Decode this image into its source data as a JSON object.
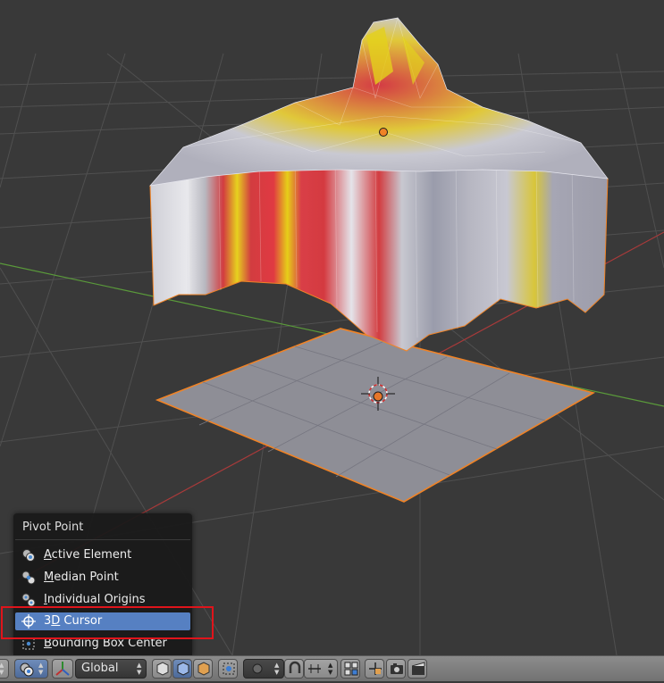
{
  "popup": {
    "title": "Pivot Point",
    "items": [
      {
        "label_hotkey": "A",
        "label_rest": "ctive Element",
        "icon": "active-element-icon",
        "selected": false
      },
      {
        "label_hotkey": "M",
        "label_rest": "edian Point",
        "icon": "median-point-icon",
        "selected": false
      },
      {
        "label_hotkey": "I",
        "label_rest": "ndividual Origins",
        "icon": "individual-origins-icon",
        "selected": false
      },
      {
        "label_pre": "3",
        "label_hotkey": "D",
        "label_rest": " Cursor",
        "icon": "cursor-3d-icon",
        "selected": true
      },
      {
        "label_hotkey": "B",
        "label_rest": "ounding Box Center",
        "icon": "bounding-box-center-icon",
        "selected": false
      }
    ]
  },
  "toolbar": {
    "orientation_value": "Global",
    "icons": [
      "pivot-point-icon",
      "transform-manipulator-icon",
      "viewport-shading-solid-icon",
      "limit-selection-icon",
      "snap-icon",
      "proportional-edit-icon",
      "snap-target-icon",
      "render-icon",
      "render-animation-icon"
    ]
  },
  "colors": {
    "viewport_bg": "#393939",
    "selection_outline": "#f08326",
    "menu_highlight": "#5680c2",
    "annotation_box": "#e0141b",
    "x_axis": "#a83a3a",
    "y_axis": "#5a9a3a"
  }
}
